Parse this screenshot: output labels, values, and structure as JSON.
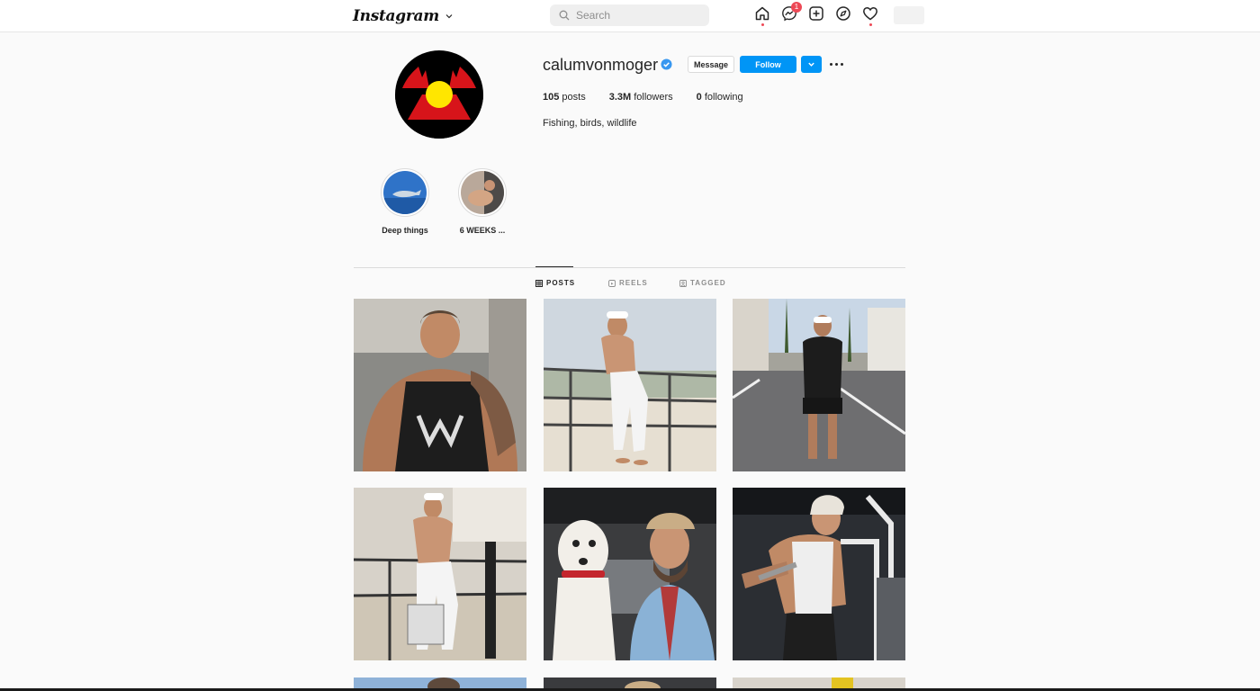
{
  "nav": {
    "logo_text": "Instagram",
    "search_placeholder": "Search",
    "messenger_badge": "1"
  },
  "profile": {
    "username": "calumvonmoger",
    "message_label": "Message",
    "follow_label": "Follow",
    "stats": {
      "posts_count": "105",
      "posts_label": "posts",
      "followers_count": "3.3M",
      "followers_label": "followers",
      "following_count": "0",
      "following_label": "following"
    },
    "bio": "Fishing, birds, wildlife"
  },
  "highlights": [
    {
      "label": "Deep things"
    },
    {
      "label": "6 WEEKS ..."
    }
  ],
  "tabs": [
    {
      "label": "POSTS"
    },
    {
      "label": "REELS"
    },
    {
      "label": "TAGGED"
    }
  ],
  "colors": {
    "accent": "#0095f6",
    "notification": "#ed4956"
  }
}
